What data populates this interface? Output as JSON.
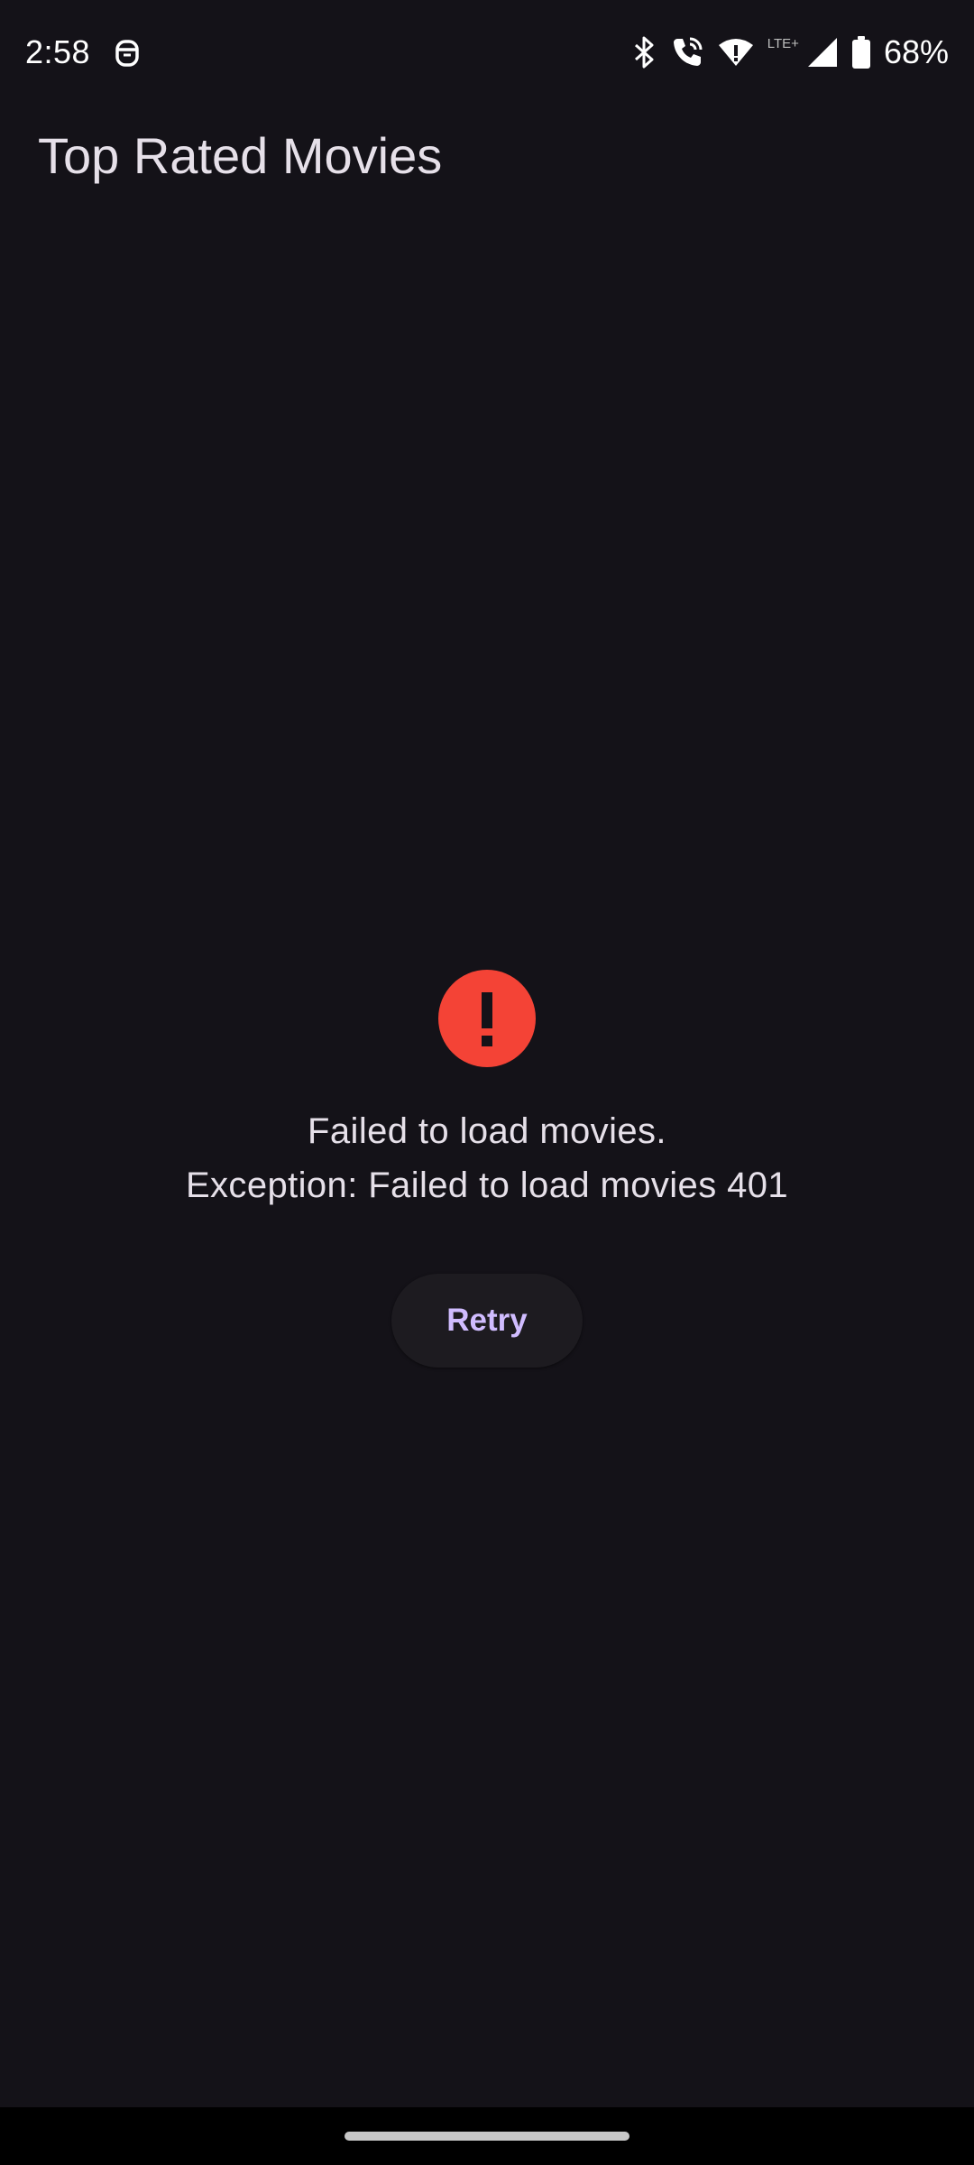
{
  "status_bar": {
    "time": "2:58",
    "battery_percent": "68%",
    "network_label": "LTE+",
    "icons": [
      "app-notification-icon",
      "bluetooth-icon",
      "wifi-calling-icon",
      "wifi-icon",
      "cell-signal-icon",
      "battery-icon"
    ]
  },
  "app_bar": {
    "title": "Top Rated Movies"
  },
  "error": {
    "icon": "error-icon",
    "icon_color": "#f44336",
    "title": "Failed to load movies.",
    "detail": "Exception: Failed to load movies 401",
    "retry_label": "Retry"
  },
  "theme": {
    "background": "#141218",
    "accent": "#d0bcff",
    "text": "#e6e0e9"
  }
}
